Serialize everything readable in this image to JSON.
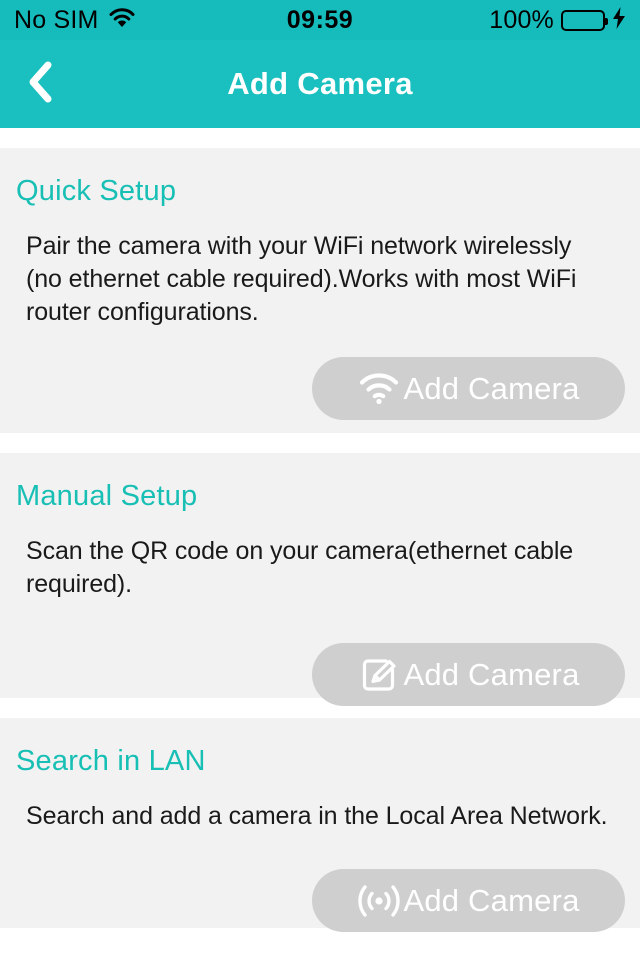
{
  "status_bar": {
    "carrier": "No SIM",
    "wifi_icon": "wifi-icon",
    "time": "09:59",
    "battery_percent": "100%",
    "battery_icon": "battery-full-icon",
    "charging_icon": "lightning-bolt-icon",
    "background_color": "#16bcbc",
    "text_color": "#000000",
    "battery_fill_color": "#5ce65c"
  },
  "nav_bar": {
    "back_icon": "chevron-left-icon",
    "title": "Add Camera",
    "background_color": "#1ac0c0",
    "title_color": "#ffffff"
  },
  "theme": {
    "accent_color": "#17bfb4",
    "card_background": "#f2f2f2",
    "page_background": "#ffffff",
    "button_background": "#cfcfcf",
    "button_text_color": "#ffffff",
    "body_text_color": "#1a1a1a"
  },
  "cards": [
    {
      "heading": "Quick Setup",
      "body": "Pair the camera with your WiFi network wirelessly (no ethernet cable required).Works with most WiFi router configurations.",
      "button_label": "Add Camera",
      "button_icon": "wifi-icon"
    },
    {
      "heading": "Manual Setup",
      "body": "Scan the QR code on your camera(ethernet cable required).",
      "button_label": "Add Camera",
      "button_icon": "pencil-square-icon"
    },
    {
      "heading": "Search in LAN",
      "body": "Search and add a camera in the Local Area Network.",
      "button_label": "Add Camera",
      "button_icon": "broadcast-signal-icon"
    }
  ]
}
